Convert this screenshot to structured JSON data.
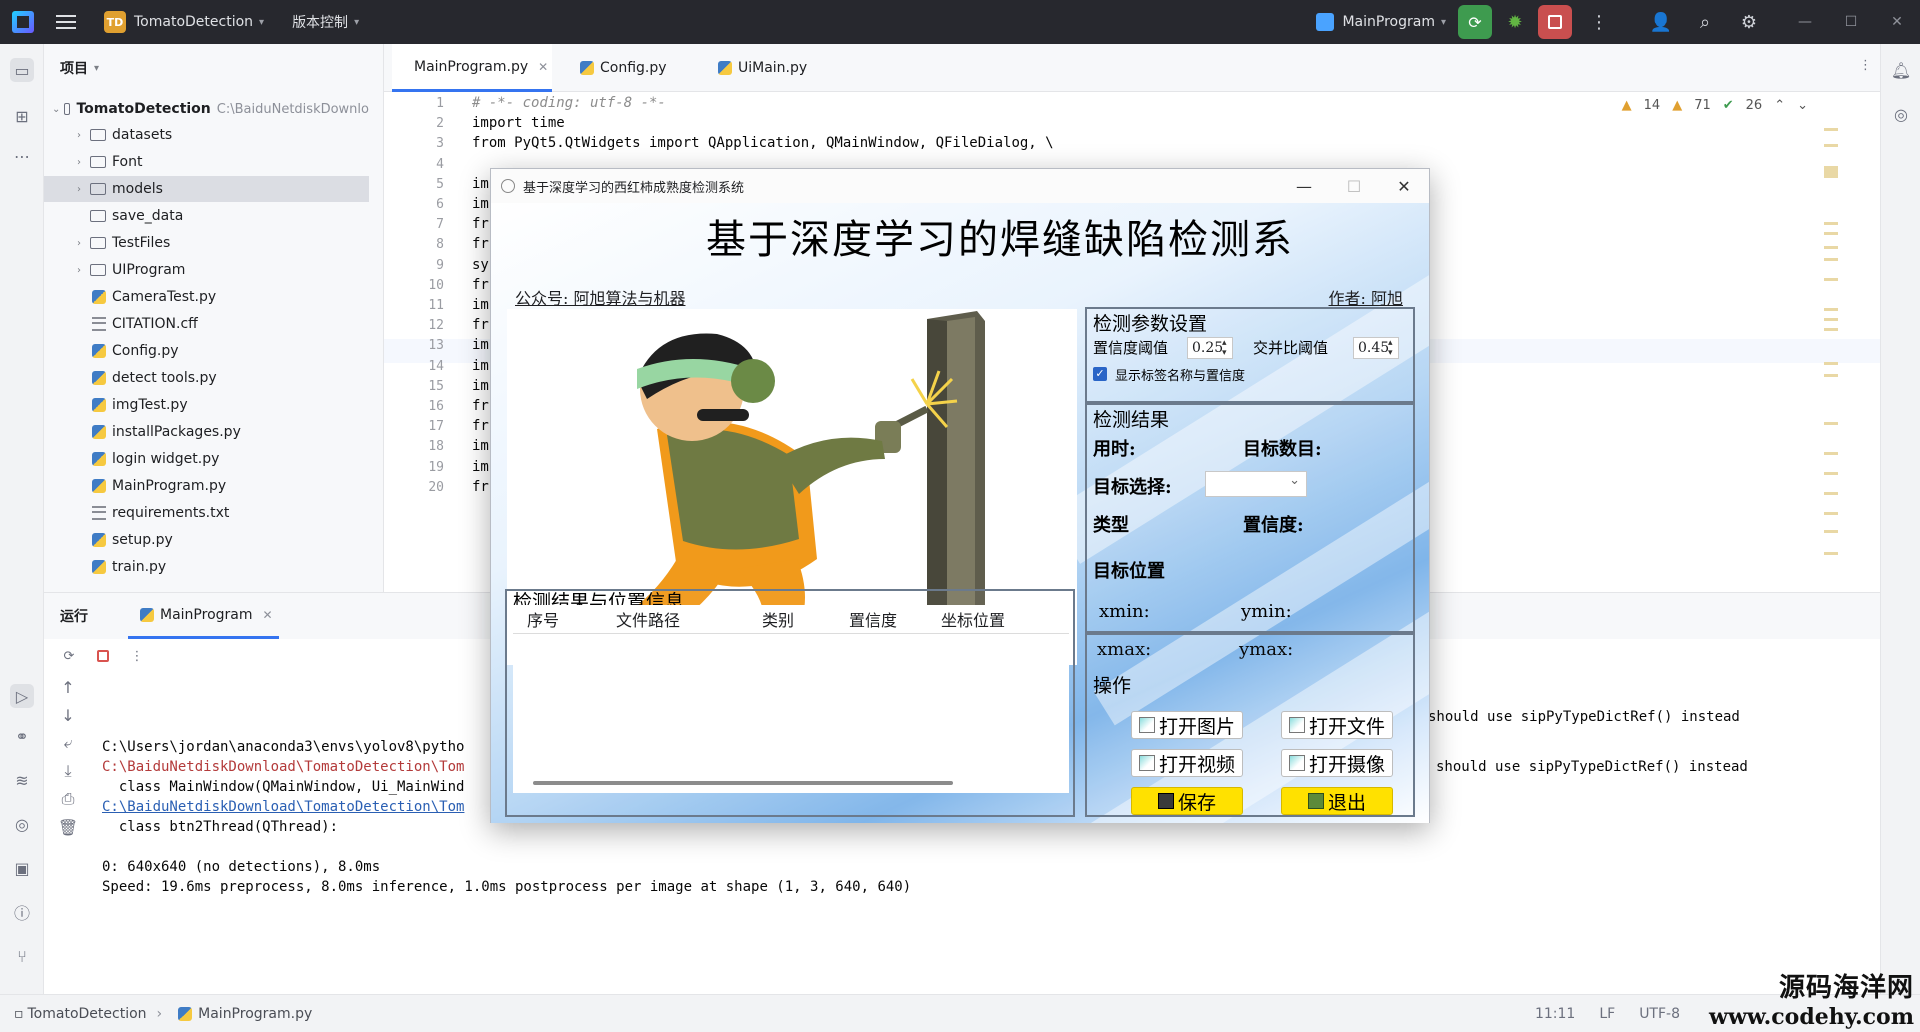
{
  "titlebar": {
    "project_badge": "TD",
    "project_name": "TomatoDetection",
    "vcs_label": "版本控制",
    "run_config": "MainProgram"
  },
  "project_panel": {
    "title": "项目",
    "root_name": "TomatoDetection",
    "root_path": "C:\\BaiduNetdiskDownlo",
    "items": [
      {
        "label": "datasets",
        "kind": "folder"
      },
      {
        "label": "Font",
        "kind": "folder"
      },
      {
        "label": "models",
        "kind": "folder"
      },
      {
        "label": "save_data",
        "kind": "folder"
      },
      {
        "label": "TestFiles",
        "kind": "folder"
      },
      {
        "label": "UIProgram",
        "kind": "folder"
      },
      {
        "label": "CameraTest.py",
        "kind": "py"
      },
      {
        "label": "CITATION.cff",
        "kind": "txt"
      },
      {
        "label": "Config.py",
        "kind": "py"
      },
      {
        "label": "detect tools.py",
        "kind": "py"
      },
      {
        "label": "imgTest.py",
        "kind": "py"
      },
      {
        "label": "installPackages.py",
        "kind": "py"
      },
      {
        "label": "login widget.py",
        "kind": "py"
      },
      {
        "label": "MainProgram.py",
        "kind": "py"
      },
      {
        "label": "requirements.txt",
        "kind": "txt"
      },
      {
        "label": "setup.py",
        "kind": "py"
      },
      {
        "label": "train.py",
        "kind": "py"
      }
    ]
  },
  "editor": {
    "tabs": [
      "MainProgram.py",
      "Config.py",
      "UiMain.py"
    ],
    "inspections": {
      "warnings": "14",
      "weak_warnings": "71",
      "ok": "26"
    },
    "lines": [
      {
        "no": "1",
        "text": "# -*- coding: utf-8 -*-"
      },
      {
        "no": "2",
        "text": "import time"
      },
      {
        "no": "3",
        "text": "from PyQt5.QtWidgets import QApplication, QMainWindow, QFileDialog, \\"
      },
      {
        "no": "4",
        "text": ""
      },
      {
        "no": "5",
        "text": "im"
      },
      {
        "no": "6",
        "text": "im"
      },
      {
        "no": "7",
        "text": "fr"
      },
      {
        "no": "8",
        "text": "fr"
      },
      {
        "no": "9",
        "text": "sy"
      },
      {
        "no": "10",
        "text": "fr"
      },
      {
        "no": "11",
        "text": "im"
      },
      {
        "no": "12",
        "text": "fr"
      },
      {
        "no": "13",
        "text": "im"
      },
      {
        "no": "14",
        "text": "im"
      },
      {
        "no": "15",
        "text": "im"
      },
      {
        "no": "16",
        "text": "fr"
      },
      {
        "no": "17",
        "text": "fr"
      },
      {
        "no": "18",
        "text": "im"
      },
      {
        "no": "19",
        "text": "im"
      },
      {
        "no": "20",
        "text": "fr"
      }
    ]
  },
  "run_panel": {
    "label": "运行",
    "tab": "MainProgram",
    "console": [
      "C:\\Users\\jordan\\anaconda3\\envs\\yolov8\\pytho",
      "C:\\BaiduNetdiskDownload\\TomatoDetection\\Tom",
      "  class MainWindow(QMainWindow, Ui_MainWind",
      "C:\\BaiduNetdiskDownload\\TomatoDetection\\Tom",
      "  class btn2Thread(QThread):",
      "",
      "0: 640x640 (no detections), 8.0ms",
      "Speed: 19.6ms preprocess, 8.0ms inference, 1.0ms postprocess per image at shape (1, 3, 640, 640)"
    ],
    "console_right_1": "should use sipPyTypeDictRef() instead",
    "console_right_2": "should use sipPyTypeDictRef() instead"
  },
  "statusbar": {
    "crumb_project": "TomatoDetection",
    "crumb_file": "MainProgram.py",
    "position": "11:11",
    "line_sep": "LF",
    "encoding": "UTF-8"
  },
  "watermark": {
    "line1": "源码海洋网",
    "line2": "www.codehy.com"
  },
  "app_window": {
    "title": "基于深度学习的西红柿成熟度检测系统",
    "header": "基于深度学习的焊缝缺陷检测系",
    "wechat": "公众号: 阿旭算法与机器",
    "author": "作者: 阿旭",
    "params": {
      "title": "检测参数设置",
      "conf_label": "置信度阈值",
      "conf_value": "0.25",
      "iou_label": "交并比阈值",
      "iou_value": "0.45",
      "show_label": "显示标签名称与置信度",
      "show_checked": true
    },
    "results": {
      "title": "检测结果",
      "time_label": "用时:",
      "count_label": "目标数目:",
      "select_label": "目标选择:",
      "type_label": "类型",
      "conf_label": "置信度:",
      "pos_label": "目标位置",
      "xmin": "xmin:",
      "ymin": "ymin:",
      "xmax": "xmax:",
      "ymax": "ymax:"
    },
    "table": {
      "title": "检测结果与位置信息",
      "headers": [
        "序号",
        "文件路径",
        "类别",
        "置信度",
        "坐标位置"
      ]
    },
    "ops": {
      "title": "操作",
      "open_image": "打开图片",
      "open_folder": "打开文件",
      "open_video": "打开视频",
      "open_camera": "打开摄像",
      "save": "保存",
      "exit": "退出"
    }
  }
}
